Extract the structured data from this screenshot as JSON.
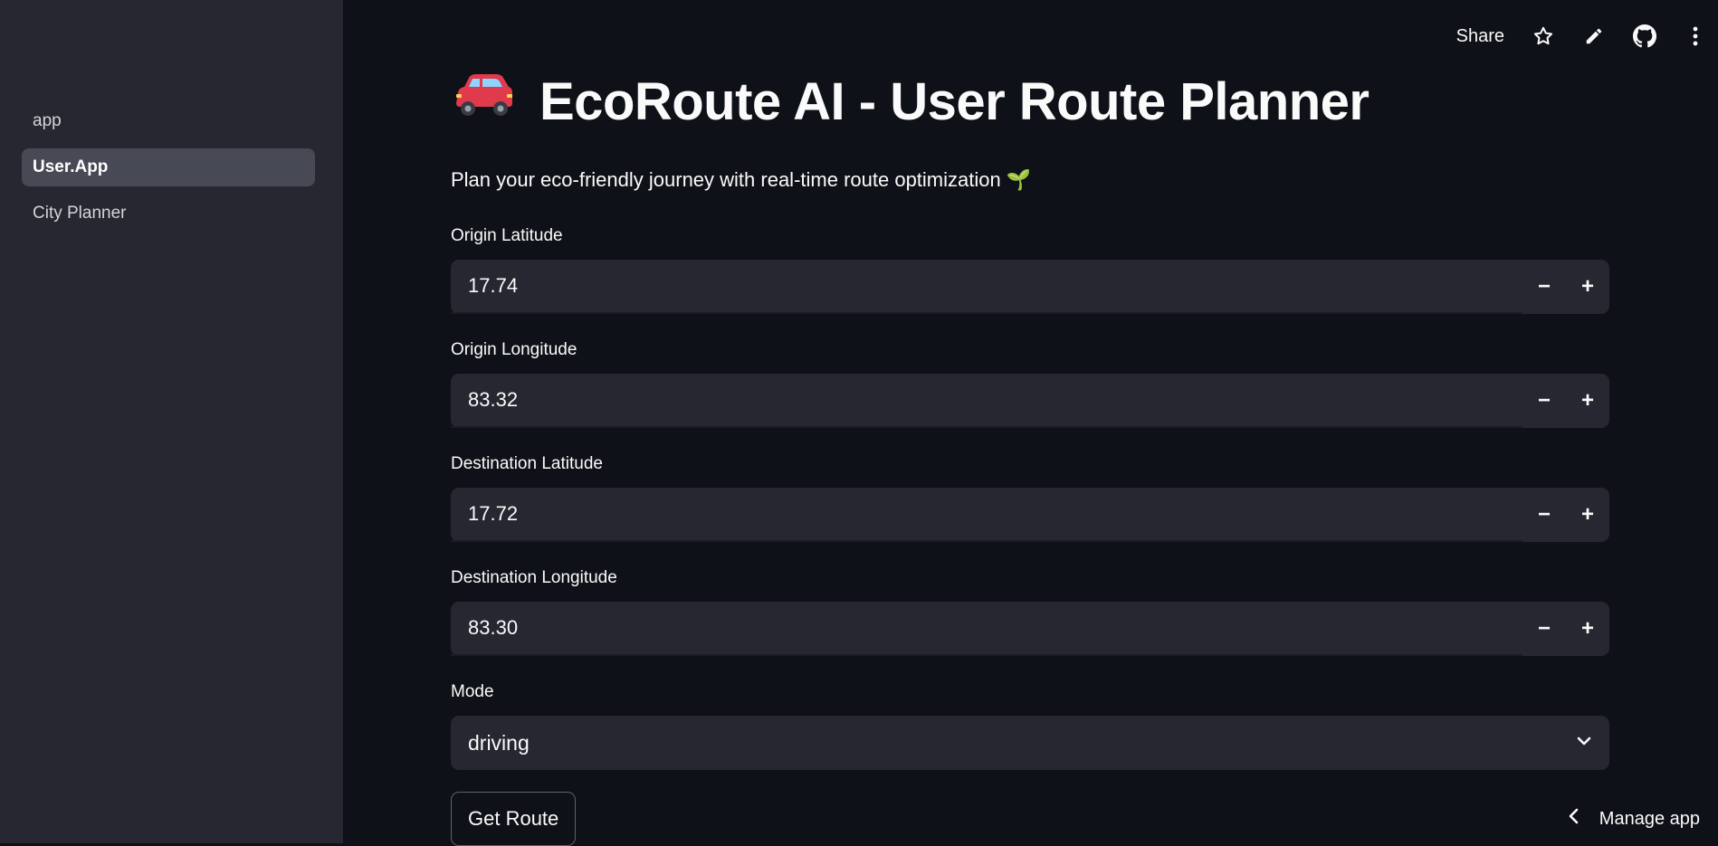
{
  "sidebar": {
    "items": [
      {
        "label": "app"
      },
      {
        "label": "User.App"
      },
      {
        "label": "City Planner"
      }
    ]
  },
  "toolbar": {
    "share_label": "Share",
    "icons": [
      "star-icon",
      "pencil-icon",
      "github-icon",
      "more-vertical-icon"
    ]
  },
  "page": {
    "title": "EcoRoute AI - User Route Planner",
    "subtitle": "Plan your eco-friendly journey with real-time route optimization 🌱"
  },
  "form": {
    "origin_lat": {
      "label": "Origin Latitude",
      "value": "17.74"
    },
    "origin_lon": {
      "label": "Origin Longitude",
      "value": "83.32"
    },
    "dest_lat": {
      "label": "Destination Latitude",
      "value": "17.72"
    },
    "dest_lon": {
      "label": "Destination Longitude",
      "value": "83.30"
    },
    "mode": {
      "label": "Mode",
      "value": "driving"
    },
    "minus": "−",
    "plus": "+",
    "submit_label": "Get Route"
  },
  "footer": {
    "manage_label": "Manage app"
  },
  "colors": {
    "background": "#0e1117",
    "sidebar": "#262730",
    "input": "#262730",
    "active_nav": "#474955",
    "text": "#fafafa"
  }
}
